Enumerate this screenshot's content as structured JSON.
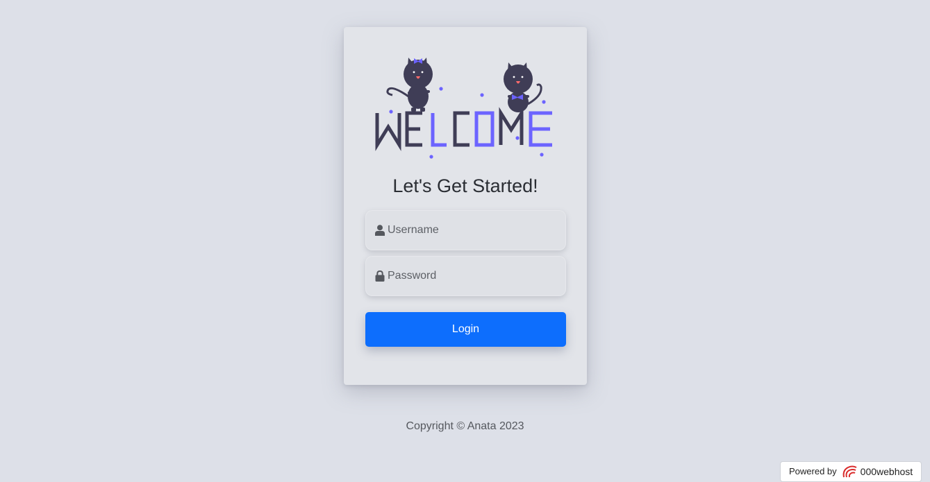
{
  "login_card": {
    "illustration_text": "WELCOME",
    "heading": "Let's Get Started!",
    "username": {
      "placeholder": "Username",
      "value": "",
      "icon": "user-icon"
    },
    "password": {
      "placeholder": "Password",
      "value": "",
      "icon": "lock-icon"
    },
    "login_label": "Login"
  },
  "footer": {
    "copyright": "Copyright © Anata 2023"
  },
  "powered_badge": {
    "prefix": "Powered by",
    "brand": "000webhost"
  },
  "colors": {
    "background": "#dde0e8",
    "card": "#e2e4e9",
    "accent": "#0d6efd",
    "illustration_accent": "#6c63ff",
    "illustration_dark": "#3f3d56"
  }
}
